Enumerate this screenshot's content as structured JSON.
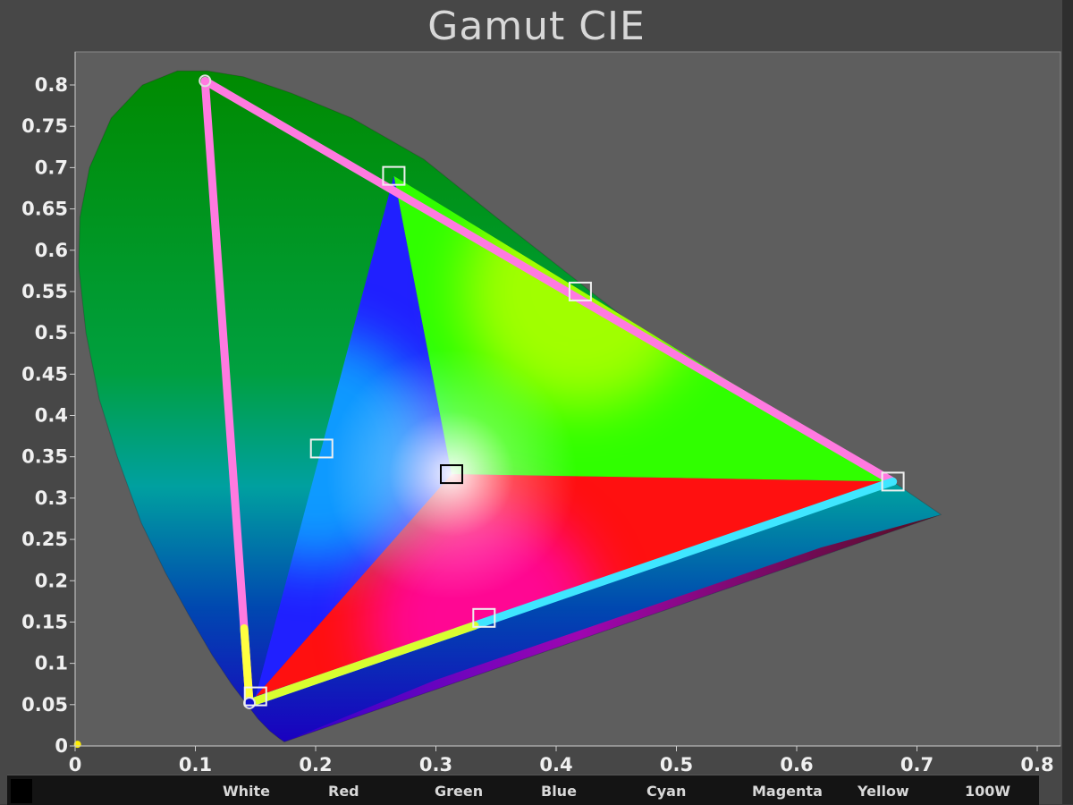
{
  "title": "Gamut CIE",
  "colors": {
    "background": "#5e5e5e",
    "frame": "#474747",
    "text": "#e8e8e8",
    "gamut_red_edge": "#ff7ae0",
    "gamut_green_blue_edge": "#3fe6ff",
    "gamut_blue_red_edge": "#ffff40"
  },
  "legend": {
    "items": [
      "White",
      "Red",
      "Green",
      "Blue",
      "Cyan",
      "Magenta",
      "Yellow",
      "100W"
    ]
  },
  "chart_data": {
    "type": "scatter",
    "title": "Gamut CIE",
    "xlabel": "",
    "ylabel": "",
    "xlim": [
      0,
      0.84
    ],
    "ylim": [
      0,
      0.84
    ],
    "x_ticks": [
      "0",
      "0.1",
      "0.2",
      "0.3",
      "0.4",
      "0.5",
      "0.6",
      "0.7",
      "0.8"
    ],
    "y_ticks": [
      "0",
      "0.05",
      "0.1",
      "0.15",
      "0.2",
      "0.25",
      "0.3",
      "0.35",
      "0.4",
      "0.45",
      "0.5",
      "0.55",
      "0.6",
      "0.65",
      "0.7",
      "0.75",
      "0.8"
    ],
    "grid": false,
    "spectral_locus": [
      [
        0.174,
        0.005
      ],
      [
        0.17,
        0.009
      ],
      [
        0.162,
        0.018
      ],
      [
        0.152,
        0.033
      ],
      [
        0.142,
        0.052
      ],
      [
        0.13,
        0.075
      ],
      [
        0.114,
        0.11
      ],
      [
        0.094,
        0.16
      ],
      [
        0.075,
        0.21
      ],
      [
        0.055,
        0.27
      ],
      [
        0.035,
        0.35
      ],
      [
        0.02,
        0.42
      ],
      [
        0.009,
        0.5
      ],
      [
        0.003,
        0.58
      ],
      [
        0.004,
        0.64
      ],
      [
        0.012,
        0.7
      ],
      [
        0.03,
        0.76
      ],
      [
        0.056,
        0.8
      ],
      [
        0.085,
        0.817
      ],
      [
        0.11,
        0.817
      ],
      [
        0.14,
        0.81
      ],
      [
        0.18,
        0.79
      ],
      [
        0.23,
        0.76
      ],
      [
        0.29,
        0.71
      ],
      [
        0.35,
        0.64
      ],
      [
        0.42,
        0.56
      ],
      [
        0.49,
        0.48
      ],
      [
        0.56,
        0.41
      ],
      [
        0.63,
        0.35
      ],
      [
        0.68,
        0.32
      ],
      [
        0.72,
        0.28
      ]
    ],
    "target_gamut": [
      [
        0.265,
        0.69
      ],
      [
        0.68,
        0.32
      ],
      [
        0.15,
        0.06
      ]
    ],
    "measured_gamut": {
      "red": [
        0.68,
        0.32
      ],
      "green": [
        0.108,
        0.805
      ],
      "blue": [
        0.145,
        0.052
      ]
    },
    "targets": [
      {
        "name": "White",
        "x": 0.313,
        "y": 0.329
      },
      {
        "name": "Red",
        "x": 0.68,
        "y": 0.32
      },
      {
        "name": "Green",
        "x": 0.265,
        "y": 0.69
      },
      {
        "name": "Blue",
        "x": 0.15,
        "y": 0.06
      },
      {
        "name": "Cyan",
        "x": 0.205,
        "y": 0.36
      },
      {
        "name": "Magenta",
        "x": 0.34,
        "y": 0.155
      },
      {
        "name": "Yellow",
        "x": 0.42,
        "y": 0.55
      }
    ]
  }
}
